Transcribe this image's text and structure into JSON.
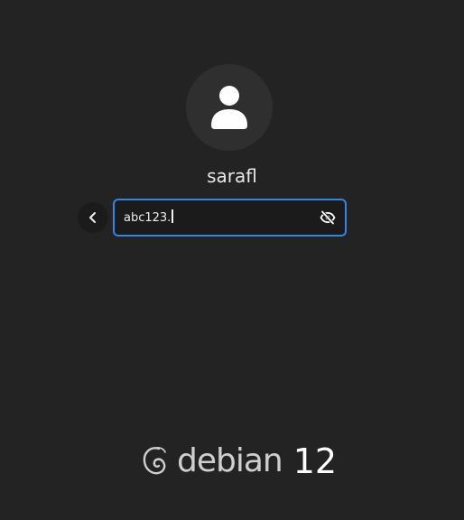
{
  "login": {
    "username": "sarafl",
    "password_value": "abc123.",
    "back_icon": "chevron-left-icon",
    "reveal_icon": "eye-slash-icon",
    "avatar_icon": "user-icon",
    "accent_color": "#3584e4"
  },
  "branding": {
    "logo_icon": "debian-swirl-icon",
    "name": "debian",
    "version": "12"
  }
}
